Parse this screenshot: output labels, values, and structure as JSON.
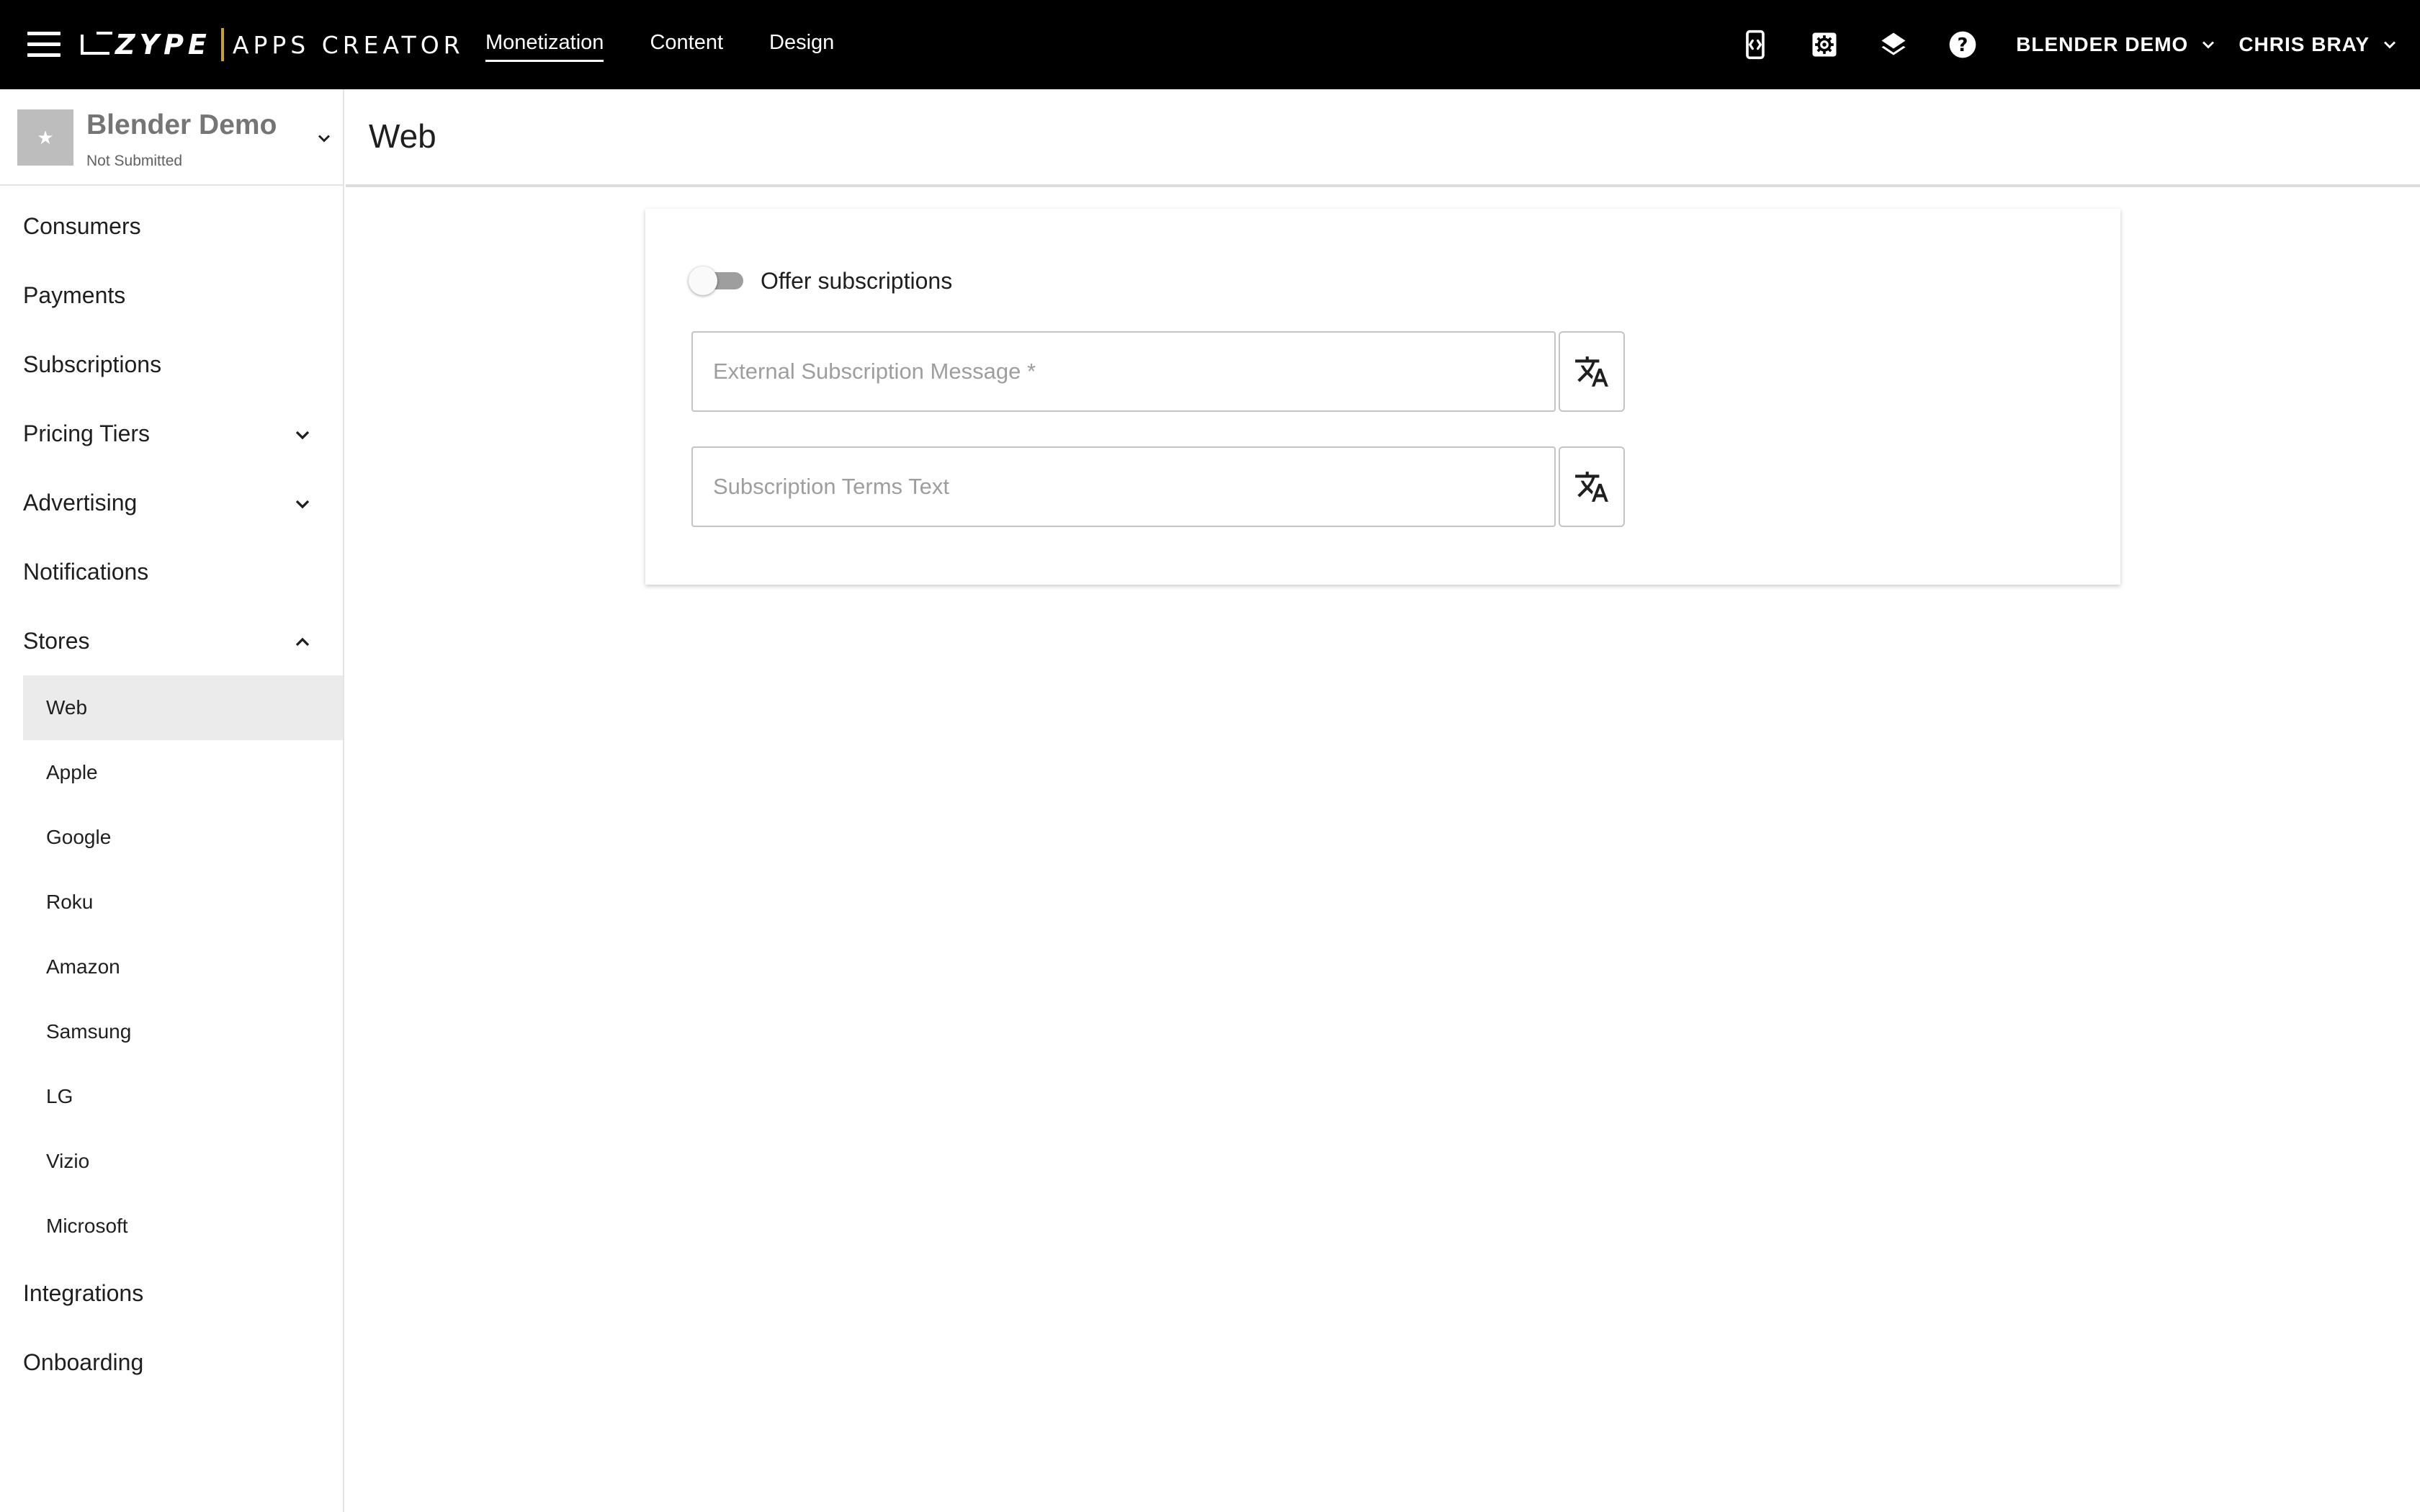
{
  "topbar": {
    "logo_brand": "ZYPE",
    "logo_product": "APPS CREATOR",
    "nav": [
      {
        "label": "Monetization",
        "active": true
      },
      {
        "label": "Content",
        "active": false
      },
      {
        "label": "Design",
        "active": false
      }
    ],
    "icons": [
      "code-preview-icon",
      "settings-icon",
      "layers-icon",
      "help-icon"
    ],
    "account_dropdown": "BLENDER DEMO",
    "user_dropdown": "CHRIS BRAY"
  },
  "sidebar": {
    "app": {
      "name": "Blender Demo",
      "status": "Not Submitted",
      "thumb_glyph": "★"
    },
    "items": [
      {
        "label": "Consumers"
      },
      {
        "label": "Payments"
      },
      {
        "label": "Subscriptions"
      },
      {
        "label": "Pricing Tiers",
        "expandable": true,
        "expanded": false
      },
      {
        "label": "Advertising",
        "expandable": true,
        "expanded": false
      },
      {
        "label": "Notifications"
      },
      {
        "label": "Stores",
        "expandable": true,
        "expanded": true
      }
    ],
    "stores": [
      {
        "label": "Web",
        "active": true
      },
      {
        "label": "Apple"
      },
      {
        "label": "Google"
      },
      {
        "label": "Roku"
      },
      {
        "label": "Amazon"
      },
      {
        "label": "Samsung"
      },
      {
        "label": "LG"
      },
      {
        "label": "Vizio"
      },
      {
        "label": "Microsoft"
      }
    ],
    "items_after": [
      {
        "label": "Integrations"
      },
      {
        "label": "Onboarding"
      }
    ]
  },
  "main": {
    "title": "Web",
    "offer_toggle": {
      "label": "Offer subscriptions",
      "on": false
    },
    "fields": [
      {
        "placeholder": "External Subscription Message *",
        "value": ""
      },
      {
        "placeholder": "Subscription Terms Text",
        "value": ""
      }
    ]
  },
  "colors": {
    "topbar_bg": "#000000",
    "logo_accent": "#c9a227",
    "active_sub_bg": "#ebebeb",
    "toggle_track_off": "#9e9e9e"
  }
}
